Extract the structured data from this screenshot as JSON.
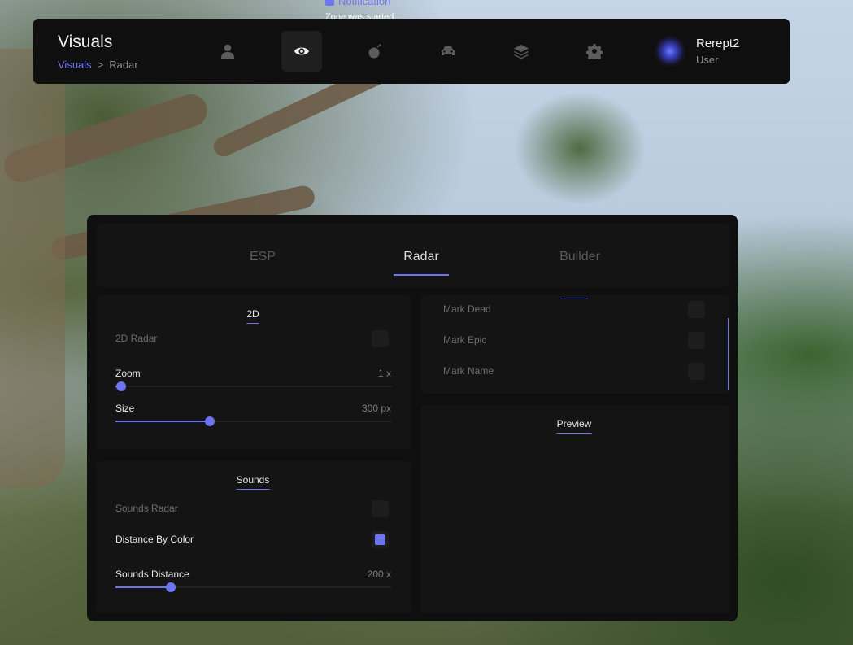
{
  "notification": {
    "title": "Notification",
    "message": "Zone was started"
  },
  "header": {
    "title": "Visuals",
    "breadcrumb": {
      "parent": "Visuals",
      "separator": ">",
      "current": "Radar"
    },
    "nav_icons": [
      "user-icon",
      "eye-icon",
      "bomb-icon",
      "car-icon",
      "layers-icon",
      "gear-icon"
    ],
    "active_nav": "eye-icon",
    "user": {
      "name": "Rerept2",
      "role": "User"
    }
  },
  "tabs": {
    "items": [
      "ESP",
      "Radar",
      "Builder"
    ],
    "active": "Radar"
  },
  "radar2d": {
    "title": "2D",
    "radar_toggle": {
      "label": "2D Radar",
      "checked": false
    },
    "zoom": {
      "label": "Zoom",
      "value_text": "1 x",
      "fraction": 0.02
    },
    "size": {
      "label": "Size",
      "value_text": "300 px",
      "fraction": 0.34
    }
  },
  "sounds": {
    "title": "Sounds",
    "radar_toggle": {
      "label": "Sounds Radar",
      "checked": false
    },
    "distance_by_color": {
      "label": "Distance By Color",
      "checked": true
    },
    "distance": {
      "label": "Sounds Distance",
      "value_text": "200 x",
      "fraction": 0.2
    }
  },
  "marks": {
    "items": [
      {
        "label": "Mark Dead",
        "checked": false
      },
      {
        "label": "Mark Epic",
        "checked": false
      },
      {
        "label": "Mark Name",
        "checked": false
      }
    ]
  },
  "preview": {
    "title": "Preview"
  },
  "colors": {
    "accent": "#6e74f0",
    "panel": "#0f0f0f",
    "card": "#141414"
  }
}
